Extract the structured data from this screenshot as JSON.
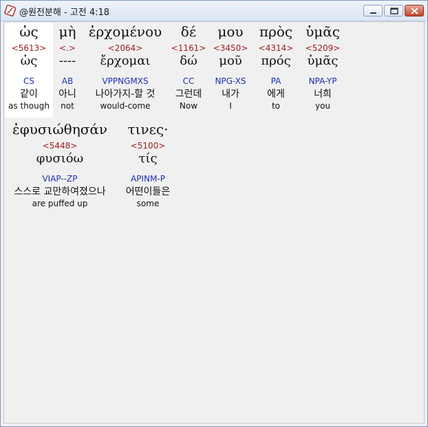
{
  "window": {
    "title": "@원전분해 - 고전 4:18",
    "icon": "app-icon"
  },
  "verse_lines": [
    [
      {
        "greek": "ὡς",
        "strong": "<5613>",
        "lemma": "ὡς",
        "parse": "CS",
        "korean": "같이",
        "english": "as though"
      },
      {
        "greek": "μὴ",
        "strong": "<.>",
        "lemma": "----",
        "parse": "AB",
        "korean": "아니",
        "english": "not"
      },
      {
        "greek": "ἐρχομένου",
        "strong": "<2064>",
        "lemma": "ἔρχομαι",
        "parse": "VPPNGMXS",
        "korean": "나아가지-할 것",
        "english": "would-come"
      },
      {
        "greek": "δέ",
        "strong": "<1161>",
        "lemma": "δώ",
        "parse": "CC",
        "korean": "그런데",
        "english": "Now"
      },
      {
        "greek": "μου",
        "strong": "<3450>",
        "lemma": "μοῦ",
        "parse": "NPG-XS",
        "korean": "내가",
        "english": "I"
      },
      {
        "greek": "πρὸς",
        "strong": "<4314>",
        "lemma": "πρός",
        "parse": "PA",
        "korean": "에게",
        "english": "to"
      },
      {
        "greek": "ὑμᾶς",
        "strong": "<5209>",
        "lemma": "ὑμᾶς",
        "parse": "NPA-YP",
        "korean": "너희",
        "english": "you"
      }
    ],
    [
      {
        "greek": "ἐφυσιώθησάν",
        "strong": "<5448>",
        "lemma": "φυσιόω",
        "parse": "VIAP--ZP",
        "korean": "스스로 교만하여졌으나",
        "english": "are puffed up"
      },
      {
        "greek": "τινες·",
        "strong": "<5100>",
        "lemma": "τίς",
        "parse": "APINM-P",
        "korean": "어떤이들은",
        "english": "some"
      }
    ]
  ]
}
